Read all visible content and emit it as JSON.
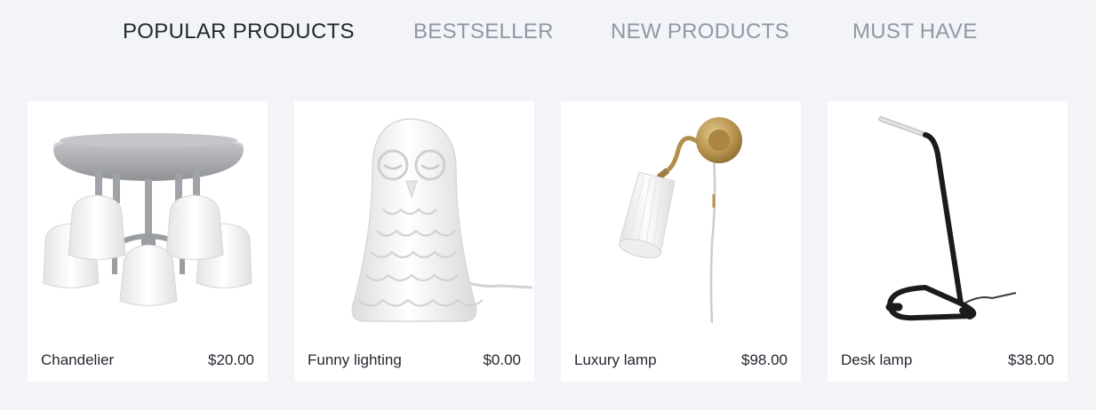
{
  "tabs": [
    {
      "label": "POPULAR PRODUCTS",
      "active": true
    },
    {
      "label": "BESTSELLER",
      "active": false
    },
    {
      "label": "NEW PRODUCTS",
      "active": false
    },
    {
      "label": "MUST HAVE",
      "active": false
    }
  ],
  "products": [
    {
      "name": "Chandelier",
      "price": "$20.00",
      "image_icon": "chandelier-icon"
    },
    {
      "name": "Funny lighting",
      "price": "$0.00",
      "image_icon": "owl-lamp-icon"
    },
    {
      "name": "Luxury lamp",
      "price": "$98.00",
      "image_icon": "wall-lamp-icon"
    },
    {
      "name": "Desk lamp",
      "price": "$38.00",
      "image_icon": "desk-lamp-icon"
    }
  ]
}
